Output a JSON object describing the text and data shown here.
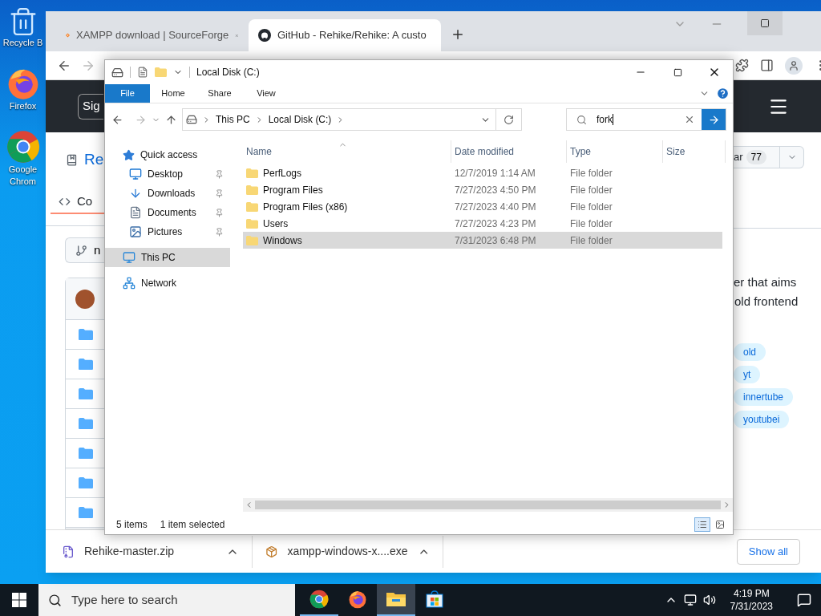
{
  "desktop_icons": [
    {
      "kind": "recycle",
      "label": "Recycle B"
    },
    {
      "kind": "firefox",
      "label": "Firefox"
    },
    {
      "kind": "chrome",
      "label": "Google Chrom"
    }
  ],
  "browser": {
    "tabs": [
      {
        "kind": "sourceforge",
        "title": "XAMPP download | SourceForge",
        "selected": false
      },
      {
        "kind": "github",
        "title": "GitHub - Rehike/Rehike: A custo",
        "selected": true
      }
    ],
    "header": {
      "sign_button": "Sig"
    },
    "left_strip": {
      "repo_title": "Re",
      "code_tab": "Co",
      "branch_button": "n"
    },
    "right_strip": {
      "star_label": "ar",
      "star_count": "77",
      "about_lines": [
        "er that aims",
        "old frontend"
      ],
      "topics": [
        "old",
        "yt",
        "innertube",
        "youtubei"
      ]
    },
    "downloads": [
      {
        "kind": "zip",
        "name": "Rehike-master.zip"
      },
      {
        "kind": "exe",
        "name": "xampp-windows-x....exe"
      }
    ],
    "show_all": "Show all"
  },
  "explorer": {
    "title": "Local Disk (C:)",
    "ribbon_tabs": [
      {
        "label": "File",
        "selected": true
      },
      {
        "label": "Home",
        "selected": false
      },
      {
        "label": "Share",
        "selected": false
      },
      {
        "label": "View",
        "selected": false
      }
    ],
    "breadcrumbs": [
      "This PC",
      "Local Disk (C:)"
    ],
    "search": {
      "value": "fork"
    },
    "nav": [
      {
        "kind": "star",
        "label": "Quick access",
        "selected": false,
        "pinned": false,
        "children": [
          {
            "kind": "desktop",
            "label": "Desktop",
            "selected": false,
            "pinned": true
          },
          {
            "kind": "download",
            "label": "Downloads",
            "selected": false,
            "pinned": true
          },
          {
            "kind": "document",
            "label": "Documents",
            "selected": false,
            "pinned": true
          },
          {
            "kind": "picture",
            "label": "Pictures",
            "selected": false,
            "pinned": true
          }
        ]
      },
      {
        "kind": "pc",
        "label": "This PC",
        "selected": true,
        "pinned": false
      },
      {
        "kind": "network",
        "label": "Network",
        "selected": false,
        "pinned": false
      }
    ],
    "columns": [
      "Name",
      "Date modified",
      "Type",
      "Size"
    ],
    "rows": [
      {
        "name": "PerfLogs",
        "date": "12/7/2019 1:14 AM",
        "type": "File folder",
        "selected": false
      },
      {
        "name": "Program Files",
        "date": "7/27/2023 4:50 PM",
        "type": "File folder",
        "selected": false
      },
      {
        "name": "Program Files (x86)",
        "date": "7/27/2023 4:40 PM",
        "type": "File folder",
        "selected": false
      },
      {
        "name": "Users",
        "date": "7/27/2023 4:23 PM",
        "type": "File folder",
        "selected": false
      },
      {
        "name": "Windows",
        "date": "7/31/2023 6:48 PM",
        "type": "File folder",
        "selected": true
      }
    ],
    "status": {
      "count": "5 items",
      "selection": "1 item selected"
    }
  },
  "taskbar": {
    "search_placeholder": "Type here to search",
    "apps": [
      {
        "kind": "chrome",
        "open": true,
        "selected": false
      },
      {
        "kind": "firefox",
        "open": false,
        "selected": false
      },
      {
        "kind": "explorer",
        "open": true,
        "selected": true
      },
      {
        "kind": "store",
        "open": false,
        "selected": false
      }
    ],
    "time": "4:19 PM",
    "date": "7/31/2023"
  }
}
